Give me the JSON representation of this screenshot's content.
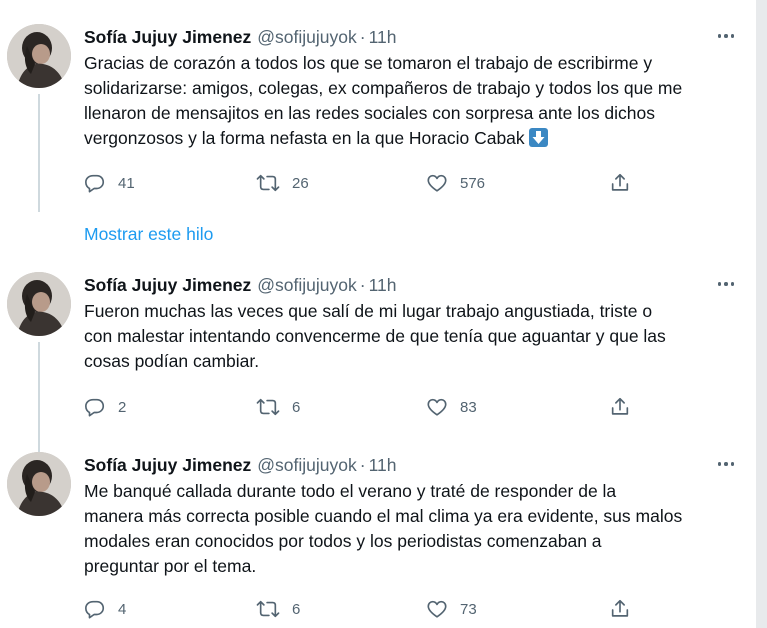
{
  "tweets": [
    {
      "name": "Sofía Jujuy Jimenez",
      "handle": "@sofijujuyok",
      "separator": "·",
      "time": "11h",
      "text_lines": [
        "Gracias de corazón a todos los que se tomaron el trabajo de escribirme y",
        "solidarizarse: amigos, colegas, ex compañeros de trabajo y todos los que me",
        "llenaron de mensajitos en las redes sociales con sorpresa ante los dichos",
        "vergonzosos y la forma nefasta en la que Horacio Cabak"
      ],
      "trailing_emoji": "down-arrow-emoji",
      "replies": "41",
      "retweets": "26",
      "likes": "576"
    },
    {
      "name": "Sofía Jujuy Jimenez",
      "handle": "@sofijujuyok",
      "separator": "·",
      "time": "11h",
      "text_lines": [
        "Fueron muchas las veces que salí de mi lugar trabajo angustiada, triste o",
        "con malestar intentando convencerme de que tenía que aguantar y que las",
        "cosas podían cambiar."
      ],
      "replies": "2",
      "retweets": "6",
      "likes": "83"
    },
    {
      "name": "Sofía Jujuy Jimenez",
      "handle": "@sofijujuyok",
      "separator": "·",
      "time": "11h",
      "text_lines": [
        "Me banqué callada durante todo el verano y traté de responder de la",
        "manera más correcta posible cuando el mal clima ya era evidente, sus malos",
        "modales eran conocidos por todos y los periodistas comenzaban a",
        "preguntar por el tema."
      ],
      "replies": "4",
      "retweets": "6",
      "likes": "73"
    }
  ],
  "show_thread_label": "Mostrar este hilo",
  "icons": {
    "reply": "reply-icon",
    "retweet": "retweet-icon",
    "like": "like-icon",
    "share": "share-icon",
    "more": "more-icon"
  },
  "colors": {
    "text": "#0f1419",
    "secondary": "#536471",
    "link": "#1d9bf0",
    "thread_line": "#cfd9de"
  }
}
